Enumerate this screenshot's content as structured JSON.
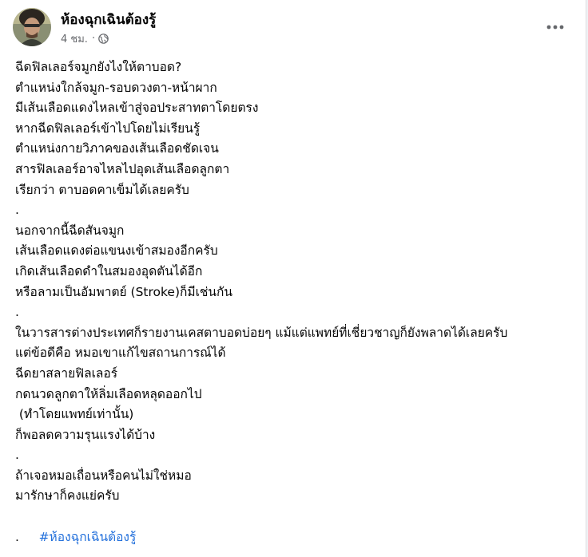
{
  "post": {
    "author": "ห้องฉุกเฉินต้องรู้",
    "time": "4 ชม.",
    "separator": "·",
    "privacy_icon": "globe-icon",
    "more_icon": "more-options-icon",
    "lines": [
      "ฉีดฟิลเลอร์จมูกยังไงให้ตาบอด?",
      "ตำแหน่งใกล้จมูก-รอบดวงตา-หน้าผาก",
      "มีเส้นเลือดแดงไหลเข้าสู่จอประสาทตาโดยตรง",
      "หากฉีดฟิลเลอร์เข้าไปโดยไม่เรียนรู้",
      "ตำแหน่งกายวิภาคของเส้นเลือดชัดเจน",
      "สารฟิลเลอร์อาจไหลไปอุดเส้นเลือดลูกตา",
      "เรียกว่า ตาบอดคาเข็มได้เลยครับ",
      ".",
      "นอกจากนี้ฉีดสันจมูก",
      "เส้นเลือดแดงต่อแขนงเข้าสมองอีกครับ",
      "เกิดเส้นเลือดดำในสมองอุดตันได้อีก",
      "หรือลามเป็นอัมพาตย์ (Stroke)ก็มีเช่นกัน",
      ".",
      "ในวารสารต่างประเทศก็รายงานเคสตาบอดบ่อยๆ แม้แต่แพทย์ที่เชี่ยวชาญก็ยังพลาดได้เลยครับ",
      "แต่ข้อดีคือ หมอเขาแก้ไขสถานการณ์ได้",
      "ฉีดยาสลายฟิลเลอร์",
      "กดนวดลูกตาให้ลิ่มเลือดหลุดออกไป",
      " (ทำโดยแพทย์เท่านั้น)",
      "ก็พอลดความรุนแรงได้บ้าง",
      ".",
      "ถ้าเจอหมอเถื่อนหรือคนไม่ใช่หมอ",
      "มารักษาก็คงแย่ครับ"
    ],
    "hashtag": "#ห้องฉุกเฉินต้องรู้",
    "trailing": ".",
    "colors": {
      "text": "#050505",
      "meta": "#65676b",
      "hashtag": "#216fdb",
      "background": "#ffffff"
    }
  }
}
